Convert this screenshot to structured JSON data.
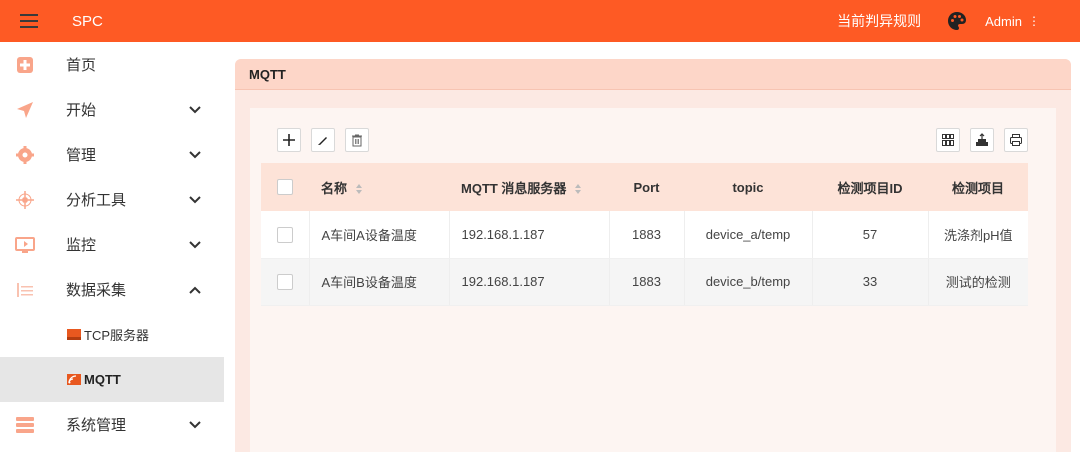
{
  "header": {
    "app_title": "SPC",
    "rule_link": "当前判异规则",
    "user": "Admin",
    "accent": "#fe5a24"
  },
  "sidebar": {
    "items": [
      {
        "label": "首页",
        "icon": "home-icon"
      },
      {
        "label": "开始",
        "icon": "send-icon"
      },
      {
        "label": "管理",
        "icon": "gear-icon"
      },
      {
        "label": "分析工具",
        "icon": "analysis-icon"
      },
      {
        "label": "监控",
        "icon": "monitor-icon"
      },
      {
        "label": "数据采集",
        "icon": "data-collection-icon"
      }
    ],
    "sub_items": [
      {
        "label": "TCP服务器",
        "icon": "tcp-server-icon"
      },
      {
        "label": "MQTT",
        "icon": "mqtt-icon"
      }
    ],
    "bottom_item": {
      "label": "系统管理",
      "icon": "system-icon"
    }
  },
  "main": {
    "card_title": "MQTT",
    "toolbar": {
      "left": [
        "add-icon",
        "edit-icon",
        "delete-icon"
      ],
      "right": [
        "columns-icon",
        "export-icon",
        "print-icon"
      ]
    },
    "table": {
      "headers": [
        "名称",
        "MQTT 消息服务器",
        "Port",
        "topic",
        "检测项目ID",
        "检测项目"
      ],
      "rows": [
        [
          "A车间A设备温度",
          "192.168.1.187",
          "1883",
          "device_a/temp",
          "57",
          "洗涤剂pH值"
        ],
        [
          "A车间B设备温度",
          "192.168.1.187",
          "1883",
          "device_b/temp",
          "33",
          "测试的检测"
        ]
      ]
    }
  }
}
